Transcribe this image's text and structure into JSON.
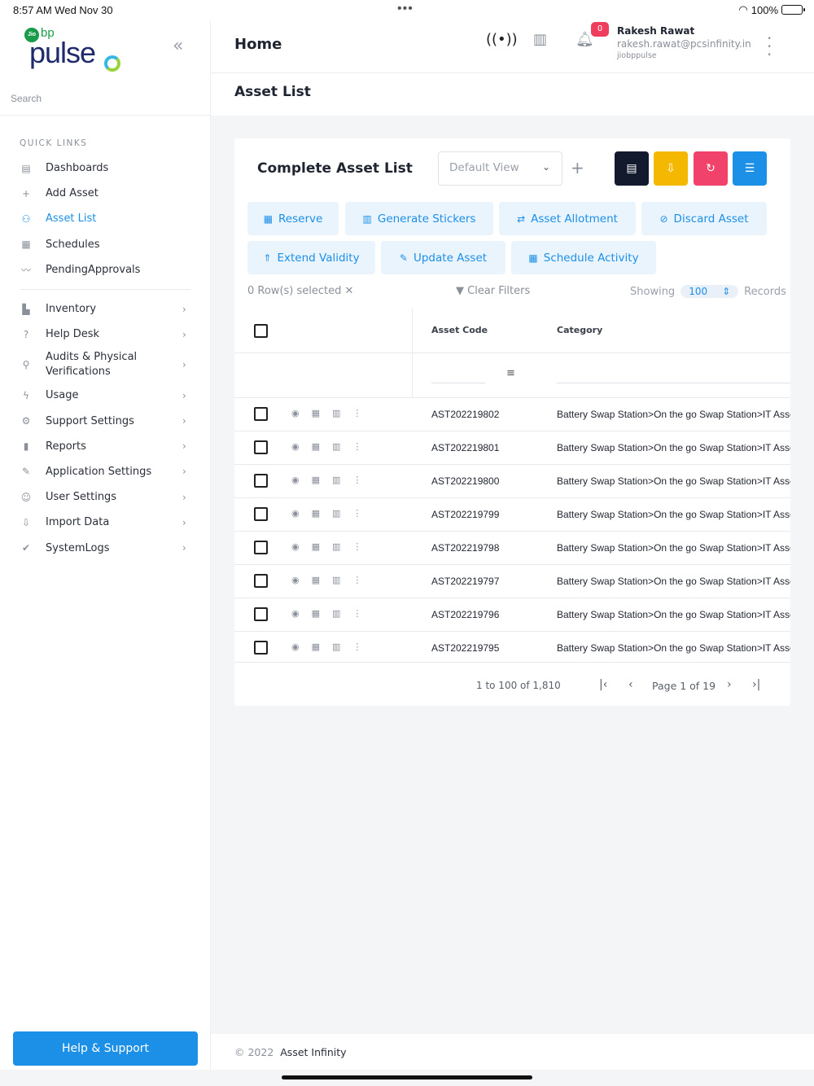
{
  "status_bar": {
    "time": "8:57 AM   Wed Nov 30",
    "dots": "•••",
    "battery": "100%"
  },
  "logo": {
    "jio": "Jio",
    "bp": "bp",
    "pulse": "pulse"
  },
  "sidebar": {
    "collapse_icon": "«",
    "search_placeholder": "Search",
    "quick_links_title": "QUICK LINKS",
    "quick_links": [
      {
        "label": "Dashboards",
        "icon": "dashboard-icon",
        "glyph": "▤"
      },
      {
        "label": "Add Asset",
        "icon": "plus-icon",
        "glyph": "+"
      },
      {
        "label": "Asset List",
        "icon": "asset-list-icon",
        "glyph": "⚇",
        "active": true
      },
      {
        "label": "Schedules",
        "icon": "calendar-icon",
        "glyph": "▦"
      },
      {
        "label": "PendingApprovals",
        "icon": "signature-icon",
        "glyph": "〰"
      }
    ],
    "menu": [
      {
        "label": "Inventory",
        "icon": "inventory-icon",
        "glyph": "▙"
      },
      {
        "label": "Help Desk",
        "icon": "help-icon",
        "glyph": "?"
      },
      {
        "label": "Audits & Physical Verifications",
        "icon": "audit-icon",
        "glyph": "⚲"
      },
      {
        "label": "Usage",
        "icon": "bolt-icon",
        "glyph": "ϟ"
      },
      {
        "label": "Support Settings",
        "icon": "cogs-icon",
        "glyph": "⚙"
      },
      {
        "label": "Reports",
        "icon": "clipboard-icon",
        "glyph": "▮"
      },
      {
        "label": "Application Settings",
        "icon": "wrench-icon",
        "glyph": "✎"
      },
      {
        "label": "User Settings",
        "icon": "user-cog-icon",
        "glyph": "☺"
      },
      {
        "label": "Import Data",
        "icon": "import-icon",
        "glyph": "⇩"
      },
      {
        "label": "SystemLogs",
        "icon": "logs-icon",
        "glyph": "✔"
      }
    ],
    "help_button": "Help & Support"
  },
  "header": {
    "title": "Home",
    "notification_count": "0",
    "user_name": "Rakesh Rawat",
    "user_email": "rakesh.rawat@pcsinfinity.in",
    "user_org": "jiobppulse"
  },
  "subheader": {
    "title": "Asset List"
  },
  "card": {
    "title": "Complete Asset List",
    "view_select": "Default View",
    "actions_row1": [
      {
        "label": "Reserve",
        "icon": "calendar-icon",
        "glyph": "▦"
      },
      {
        "label": "Generate Stickers",
        "icon": "barcode-icon",
        "glyph": "▥"
      },
      {
        "label": "Asset Allotment",
        "icon": "swap-icon",
        "glyph": "⇄"
      },
      {
        "label": "Discard Asset",
        "icon": "ban-icon",
        "glyph": "⊘"
      }
    ],
    "actions_row2": [
      {
        "label": "Extend Validity",
        "icon": "double-up-icon",
        "glyph": "⇑"
      },
      {
        "label": "Update Asset",
        "icon": "edit-icon",
        "glyph": "✎"
      },
      {
        "label": "Schedule Activity",
        "icon": "calendar-check-icon",
        "glyph": "▦"
      }
    ],
    "rows_selected": "0  Row(s) selected",
    "clear_filters": "Clear Filters",
    "showing_label": "Showing",
    "page_size": "100",
    "records_label": "Records",
    "columns": {
      "code": "Asset Code",
      "category": "Category"
    },
    "rows": [
      {
        "code": "AST202219802",
        "category": "Battery Swap Station>On the go Swap Station>IT Asset"
      },
      {
        "code": "AST202219801",
        "category": "Battery Swap Station>On the go Swap Station>IT Asset"
      },
      {
        "code": "AST202219800",
        "category": "Battery Swap Station>On the go Swap Station>IT Asset"
      },
      {
        "code": "AST202219799",
        "category": "Battery Swap Station>On the go Swap Station>IT Asset"
      },
      {
        "code": "AST202219798",
        "category": "Battery Swap Station>On the go Swap Station>IT Asset"
      },
      {
        "code": "AST202219797",
        "category": "Battery Swap Station>On the go Swap Station>IT Asset"
      },
      {
        "code": "AST202219796",
        "category": "Battery Swap Station>On the go Swap Station>IT Asset"
      },
      {
        "code": "AST202219795",
        "category": "Battery Swap Station>On the go Swap Station>IT Asset"
      }
    ],
    "pager": {
      "range": "1 to 100 of 1,810",
      "page": "Page 1 of 19"
    }
  },
  "footer": {
    "copyright": "© 2022",
    "brand": "Asset Infinity"
  },
  "colors": {
    "primary": "#1c8fe6",
    "dark": "#141a2e",
    "yellow": "#f5b800",
    "pink": "#f0426a",
    "badge": "#ef3d5e"
  }
}
